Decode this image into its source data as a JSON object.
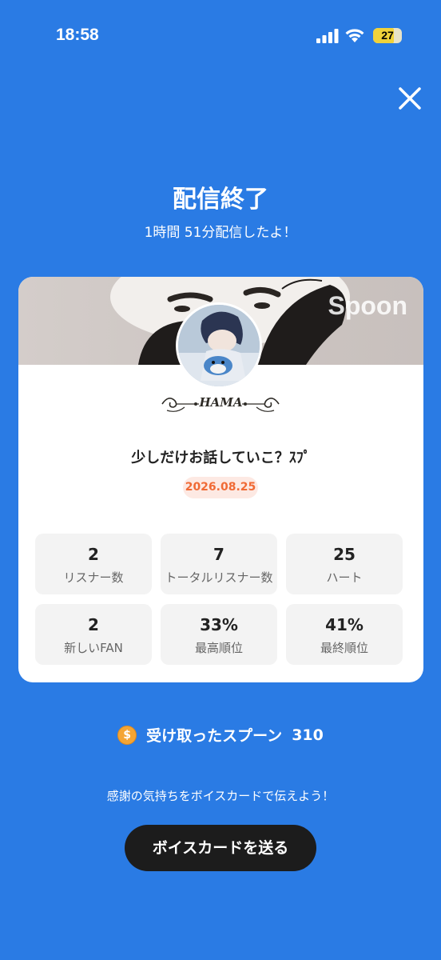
{
  "status_bar": {
    "time": "18:58",
    "battery": "27"
  },
  "header": {
    "title": "配信終了",
    "subtitle": "1時間 51分配信したよ！"
  },
  "card": {
    "brand": "Spoon",
    "dj_name": "HAMA",
    "broadcast_title": "少しだけお話していこ？ｽﾌﾟ",
    "date": "2026.08.25",
    "stats": [
      {
        "value": "2",
        "label": "リスナー数"
      },
      {
        "value": "7",
        "label": "トータルリスナー数"
      },
      {
        "value": "25",
        "label": "ハート"
      },
      {
        "value": "2",
        "label": "新しいFAN"
      },
      {
        "value": "33%",
        "label": "最高順位"
      },
      {
        "value": "41%",
        "label": "最終順位"
      }
    ]
  },
  "spoon": {
    "coin_symbol": "$",
    "label": "受け取ったスプーン",
    "count": "310"
  },
  "thanks_text": "感謝の気持ちをボイスカードで伝えよう！",
  "voice_card_button": "ボイスカードを送る",
  "colors": {
    "background": "#2a7be4",
    "date_badge_text": "#f06a35",
    "button_bg": "#1c1c1c"
  }
}
